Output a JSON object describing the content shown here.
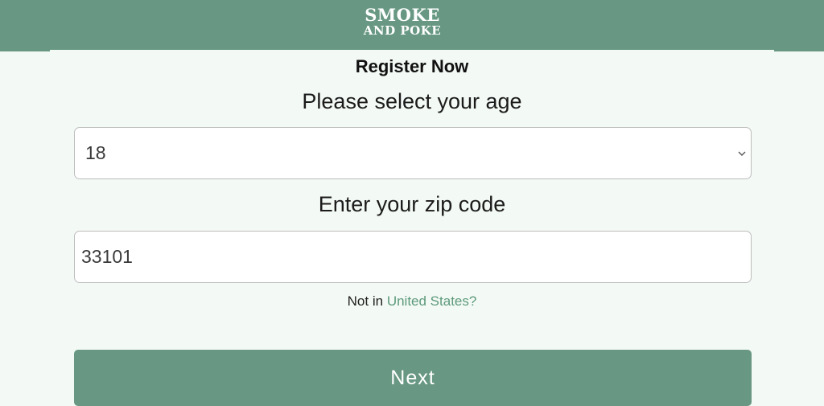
{
  "header": {
    "logo_line1": "SMOKE",
    "logo_line2": "AND POKE"
  },
  "form": {
    "title": "Register Now",
    "age_label": "Please select your age",
    "age_value": "18",
    "zip_label": "Enter your zip code",
    "zip_value": "33101",
    "country_prefix": "Not in",
    "country_link": "United States?",
    "next_label": "Next"
  },
  "colors": {
    "brand": "#689883",
    "background": "#f3f9f4",
    "link": "#5d9a7c"
  },
  "icons": {
    "select_arrow": "chevron-down-icon"
  }
}
